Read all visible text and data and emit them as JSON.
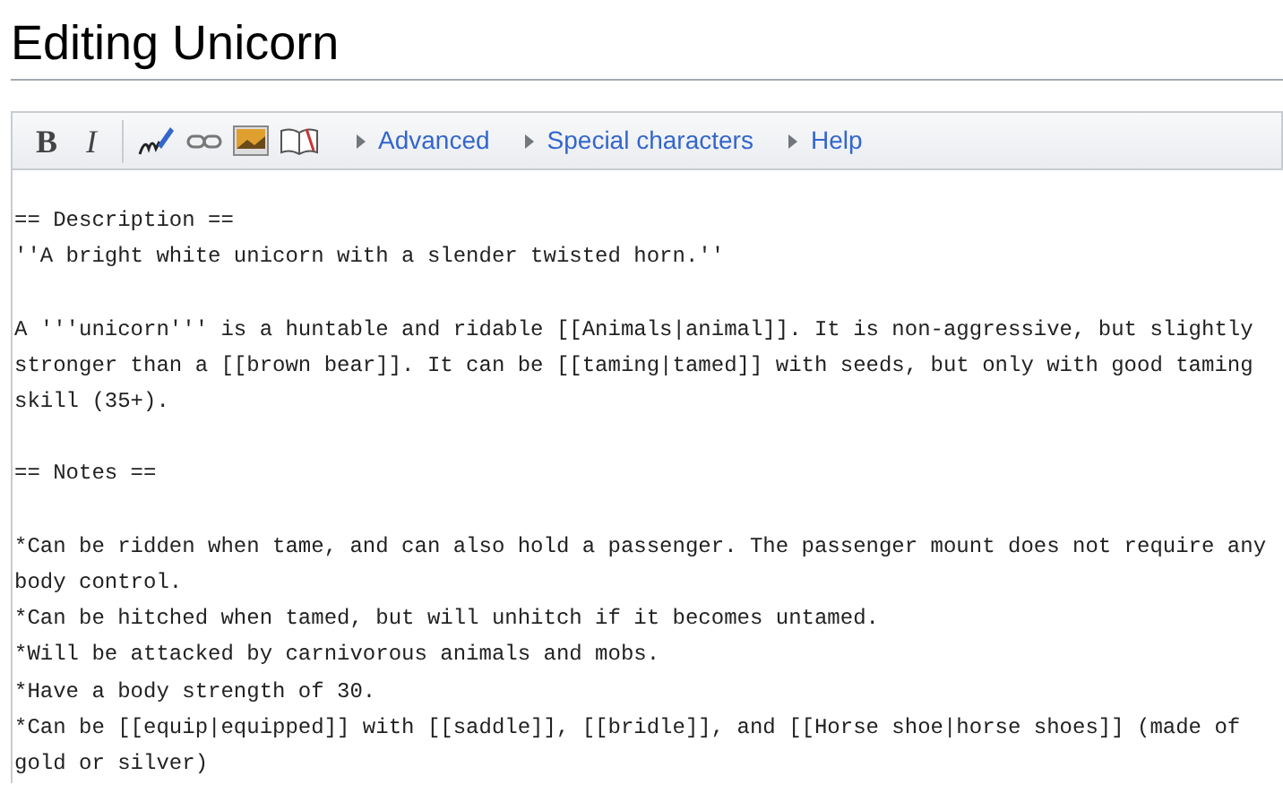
{
  "page_title": "Editing Unicorn",
  "toolbar": {
    "format_buttons": [
      {
        "label": "B",
        "kind": "bold"
      },
      {
        "label": "I",
        "kind": "italic"
      }
    ],
    "icons": [
      {
        "kind": "signature"
      },
      {
        "kind": "link"
      },
      {
        "kind": "image"
      },
      {
        "kind": "book"
      }
    ],
    "sections": [
      {
        "label": "Advanced",
        "expanded": false
      },
      {
        "label": "Special characters",
        "expanded": false
      },
      {
        "label": "Help",
        "expanded": false
      }
    ]
  },
  "editor": {
    "paragraphs": [
      [
        "== Description ==",
        "''A bright white unicorn with a slender twisted horn.''"
      ],
      [
        "A '''unicorn''' is a huntable and ridable [[Animals|animal]]. It is non-aggressive, but slightly",
        "stronger than a [[brown bear]]. It can be [[taming|tamed]] with seeds, but only with good taming",
        "skill (35+)."
      ],
      [
        "== Notes =="
      ],
      [
        "*Can be ridden when tame, and can also hold a passenger. The passenger mount does not require any",
        "body control.",
        "*Can be hitched when tamed, but will unhitch if it becomes untamed.",
        "*Will be attacked by carnivorous animals and mobs.",
        "*Have a body strength of 30.",
        "*Can be [[equip|equipped]] with [[saddle]], [[bridle]], and [[Horse shoe|horse shoes]] (made of",
        "gold or silver)"
      ]
    ]
  }
}
